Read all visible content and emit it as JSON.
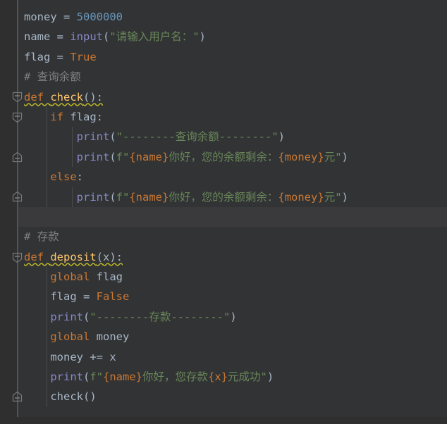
{
  "editor": {
    "theme_name": "darcula",
    "background": "#313335",
    "gutter_background": "#2f2f2f",
    "caret_line_background": "#3a3a3c",
    "default_text_color": "#a9b7c6",
    "colors": {
      "keyword": "#cc7832",
      "function_definition": "#ffc66d",
      "number": "#6897bb",
      "string": "#6a8759",
      "builtin_function": "#8888c6",
      "comment": "#808080",
      "brace_interpolation": "#cc7832",
      "warning_underline": "#bbb529",
      "indent_guide": "#4b4b4b",
      "fold_rail": "#5a5a5a"
    },
    "language": "python"
  },
  "lines": [
    {
      "n": 1,
      "indent": 0,
      "caret": false,
      "fold": null,
      "guides": 0,
      "tokens": [
        {
          "t": "money ",
          "c": "plain"
        },
        {
          "t": "= ",
          "c": "plain"
        },
        {
          "t": "5000000",
          "c": "num"
        }
      ]
    },
    {
      "n": 2,
      "indent": 0,
      "caret": false,
      "fold": null,
      "guides": 0,
      "tokens": [
        {
          "t": "name ",
          "c": "plain"
        },
        {
          "t": "= ",
          "c": "plain"
        },
        {
          "t": "input",
          "c": "func"
        },
        {
          "t": "(",
          "c": "plain"
        },
        {
          "t": "\"请输入用户名：\"",
          "c": "str"
        },
        {
          "t": ")",
          "c": "plain"
        }
      ]
    },
    {
      "n": 3,
      "indent": 0,
      "caret": false,
      "fold": null,
      "guides": 0,
      "tokens": [
        {
          "t": "flag ",
          "c": "plain"
        },
        {
          "t": "= ",
          "c": "plain"
        },
        {
          "t": "True",
          "c": "kw"
        }
      ]
    },
    {
      "n": 4,
      "indent": 0,
      "caret": false,
      "fold": null,
      "guides": 0,
      "tokens": [
        {
          "t": "# 查询余额",
          "c": "cmt"
        }
      ]
    },
    {
      "n": 5,
      "indent": 0,
      "caret": false,
      "fold": "start",
      "guides": 0,
      "tokens": [
        {
          "t": "def ",
          "c": "kw wavy"
        },
        {
          "t": "check",
          "c": "def-name wavy"
        },
        {
          "t": "():",
          "c": "plain wavy"
        }
      ]
    },
    {
      "n": 6,
      "indent": 1,
      "caret": false,
      "fold": "start",
      "guides": 1,
      "tokens": [
        {
          "t": "    ",
          "c": "plain"
        },
        {
          "t": "if ",
          "c": "kw"
        },
        {
          "t": "flag:",
          "c": "plain"
        }
      ]
    },
    {
      "n": 7,
      "indent": 2,
      "caret": false,
      "fold": null,
      "guides": 2,
      "tokens": [
        {
          "t": "        ",
          "c": "plain"
        },
        {
          "t": "print",
          "c": "func"
        },
        {
          "t": "(",
          "c": "plain"
        },
        {
          "t": "\"--------查询余额--------\"",
          "c": "str"
        },
        {
          "t": ")",
          "c": "plain"
        }
      ]
    },
    {
      "n": 8,
      "indent": 2,
      "caret": false,
      "fold": "end",
      "guides": 2,
      "tokens": [
        {
          "t": "        ",
          "c": "plain"
        },
        {
          "t": "print",
          "c": "func"
        },
        {
          "t": "(",
          "c": "plain"
        },
        {
          "t": "f\"",
          "c": "str"
        },
        {
          "t": "{name}",
          "c": "brace"
        },
        {
          "t": "你好，您的余额剩余：",
          "c": "str"
        },
        {
          "t": "{money}",
          "c": "brace"
        },
        {
          "t": "元\"",
          "c": "str"
        },
        {
          "t": ")",
          "c": "plain"
        }
      ]
    },
    {
      "n": 9,
      "indent": 1,
      "caret": false,
      "fold": null,
      "guides": 1,
      "tokens": [
        {
          "t": "    ",
          "c": "plain"
        },
        {
          "t": "else",
          "c": "kw"
        },
        {
          "t": ":",
          "c": "plain"
        }
      ]
    },
    {
      "n": 10,
      "indent": 2,
      "caret": false,
      "fold": "end",
      "guides": 2,
      "tokens": [
        {
          "t": "        ",
          "c": "plain"
        },
        {
          "t": "print",
          "c": "func"
        },
        {
          "t": "(",
          "c": "plain"
        },
        {
          "t": "f\"",
          "c": "str"
        },
        {
          "t": "{name}",
          "c": "brace"
        },
        {
          "t": "你好，您的余额剩余：",
          "c": "str"
        },
        {
          "t": "{money}",
          "c": "brace"
        },
        {
          "t": "元\"",
          "c": "str"
        },
        {
          "t": ")",
          "c": "plain"
        }
      ]
    },
    {
      "n": 11,
      "indent": 0,
      "caret": true,
      "fold": null,
      "guides": 0,
      "tokens": []
    },
    {
      "n": 12,
      "indent": 0,
      "caret": false,
      "fold": null,
      "guides": 0,
      "tokens": [
        {
          "t": "# 存款",
          "c": "cmt"
        }
      ]
    },
    {
      "n": 13,
      "indent": 0,
      "caret": false,
      "fold": "start",
      "guides": 0,
      "tokens": [
        {
          "t": "def ",
          "c": "kw wavy"
        },
        {
          "t": "deposit",
          "c": "def-name wavy"
        },
        {
          "t": "(",
          "c": "plain wavy"
        },
        {
          "t": "x",
          "c": "plain wavy"
        },
        {
          "t": "):",
          "c": "plain wavy"
        }
      ]
    },
    {
      "n": 14,
      "indent": 1,
      "caret": false,
      "fold": null,
      "guides": 1,
      "tokens": [
        {
          "t": "    ",
          "c": "plain"
        },
        {
          "t": "global ",
          "c": "kw"
        },
        {
          "t": "flag",
          "c": "plain"
        }
      ]
    },
    {
      "n": 15,
      "indent": 1,
      "caret": false,
      "fold": null,
      "guides": 1,
      "tokens": [
        {
          "t": "    ",
          "c": "plain"
        },
        {
          "t": "flag ",
          "c": "plain"
        },
        {
          "t": "= ",
          "c": "plain"
        },
        {
          "t": "False",
          "c": "kw"
        }
      ]
    },
    {
      "n": 16,
      "indent": 1,
      "caret": false,
      "fold": null,
      "guides": 1,
      "tokens": [
        {
          "t": "    ",
          "c": "plain"
        },
        {
          "t": "print",
          "c": "func"
        },
        {
          "t": "(",
          "c": "plain"
        },
        {
          "t": "\"--------存款--------\"",
          "c": "str"
        },
        {
          "t": ")",
          "c": "plain"
        }
      ]
    },
    {
      "n": 17,
      "indent": 1,
      "caret": false,
      "fold": null,
      "guides": 1,
      "tokens": [
        {
          "t": "    ",
          "c": "plain"
        },
        {
          "t": "global ",
          "c": "kw"
        },
        {
          "t": "money",
          "c": "plain"
        }
      ]
    },
    {
      "n": 18,
      "indent": 1,
      "caret": false,
      "fold": null,
      "guides": 1,
      "tokens": [
        {
          "t": "    ",
          "c": "plain"
        },
        {
          "t": "money ",
          "c": "plain"
        },
        {
          "t": "+= ",
          "c": "plain"
        },
        {
          "t": "x",
          "c": "plain"
        }
      ]
    },
    {
      "n": 19,
      "indent": 1,
      "caret": false,
      "fold": null,
      "guides": 1,
      "tokens": [
        {
          "t": "    ",
          "c": "plain"
        },
        {
          "t": "print",
          "c": "func"
        },
        {
          "t": "(",
          "c": "plain"
        },
        {
          "t": "f\"",
          "c": "str"
        },
        {
          "t": "{name}",
          "c": "brace"
        },
        {
          "t": "你好，您存款",
          "c": "str"
        },
        {
          "t": "{x}",
          "c": "brace"
        },
        {
          "t": "元成功\"",
          "c": "str"
        },
        {
          "t": ")",
          "c": "plain"
        }
      ]
    },
    {
      "n": 20,
      "indent": 1,
      "caret": false,
      "fold": "end",
      "guides": 1,
      "tokens": [
        {
          "t": "    ",
          "c": "plain"
        },
        {
          "t": "check",
          "c": "plain"
        },
        {
          "t": "()",
          "c": "plain"
        }
      ]
    }
  ],
  "source_text": "money = 5000000\nname = input(\"请输入用户名：\")\nflag = True\n# 查询余额\ndef check():\n    if flag:\n        print(\"--------查询余额--------\")\n        print(f\"{name}你好，您的余额剩余：{money}元\")\n    else:\n        print(f\"{name}你好，您的余额剩余：{money}元\")\n\n# 存款\ndef deposit(x):\n    global flag\n    flag = False\n    print(\"--------存款--------\")\n    global money\n    money += x\n    print(f\"{name}你好，您存款{x}元成功\")\n    check()"
}
